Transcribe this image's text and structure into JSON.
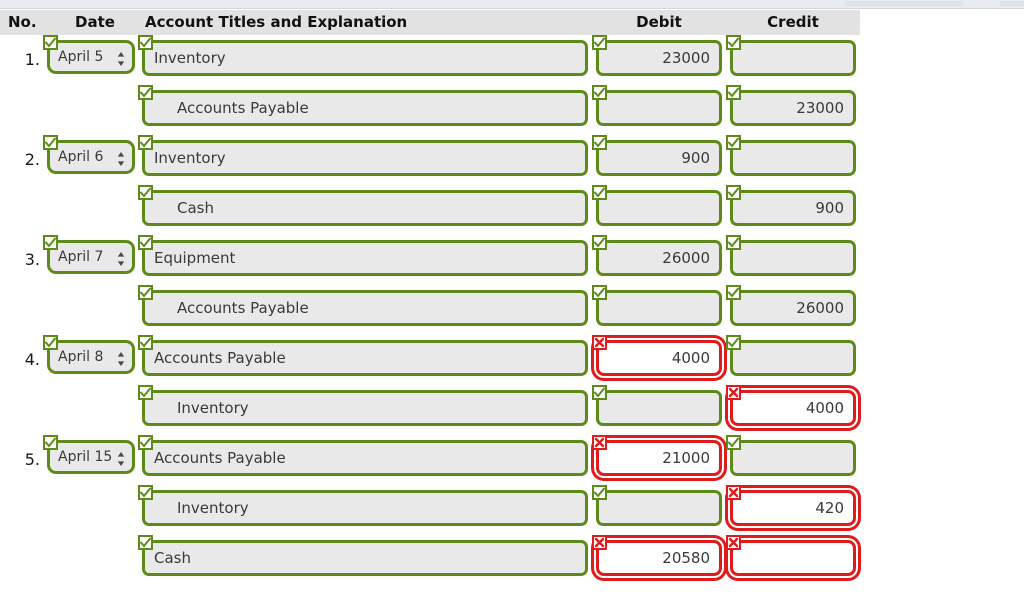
{
  "header": {
    "columns": [
      {
        "key": "no",
        "label": "No."
      },
      {
        "key": "date",
        "label": "Date"
      },
      {
        "key": "acct",
        "label": "Account Titles and Explanation"
      },
      {
        "key": "debit",
        "label": "Debit"
      },
      {
        "key": "credit",
        "label": "Credit"
      }
    ]
  },
  "colors": {
    "valid_border": "#5d8a18",
    "error_border": "#e01b1b",
    "input_bg": "#e9e9e9",
    "header_bg": "#e2e2e2",
    "page_bg": "#ffffff"
  },
  "icons": {
    "check": "check-icon",
    "error": "x-icon",
    "spinner": "updown-arrows-icon"
  },
  "entries": [
    {
      "no": "1.",
      "lines": [
        {
          "date": "April 5",
          "date_status": "valid",
          "account": "Inventory",
          "account_status": "valid",
          "indent": false,
          "debit": "23000",
          "debit_status": "valid",
          "credit": "",
          "credit_status": "valid"
        },
        {
          "date": "",
          "date_status": null,
          "account": "Accounts Payable",
          "account_status": "valid",
          "indent": true,
          "debit": "",
          "debit_status": "valid",
          "credit": "23000",
          "credit_status": "valid"
        }
      ]
    },
    {
      "no": "2.",
      "lines": [
        {
          "date": "April 6",
          "date_status": "valid",
          "account": "Inventory",
          "account_status": "valid",
          "indent": false,
          "debit": "900",
          "debit_status": "valid",
          "credit": "",
          "credit_status": "valid"
        },
        {
          "date": "",
          "date_status": null,
          "account": "Cash",
          "account_status": "valid",
          "indent": true,
          "debit": "",
          "debit_status": "valid",
          "credit": "900",
          "credit_status": "valid"
        }
      ]
    },
    {
      "no": "3.",
      "lines": [
        {
          "date": "April 7",
          "date_status": "valid",
          "account": "Equipment",
          "account_status": "valid",
          "indent": false,
          "debit": "26000",
          "debit_status": "valid",
          "credit": "",
          "credit_status": "valid"
        },
        {
          "date": "",
          "date_status": null,
          "account": "Accounts Payable",
          "account_status": "valid",
          "indent": true,
          "debit": "",
          "debit_status": "valid",
          "credit": "26000",
          "credit_status": "valid"
        }
      ]
    },
    {
      "no": "4.",
      "lines": [
        {
          "date": "April 8",
          "date_status": "valid",
          "account": "Accounts Payable",
          "account_status": "valid",
          "indent": false,
          "debit": "4000",
          "debit_status": "error",
          "credit": "",
          "credit_status": "valid"
        },
        {
          "date": "",
          "date_status": null,
          "account": "Inventory",
          "account_status": "valid",
          "indent": true,
          "debit": "",
          "debit_status": "valid",
          "credit": "4000",
          "credit_status": "error"
        }
      ]
    },
    {
      "no": "5.",
      "lines": [
        {
          "date": "April 15",
          "date_status": "valid",
          "account": "Accounts Payable",
          "account_status": "valid",
          "indent": false,
          "debit": "21000",
          "debit_status": "error",
          "credit": "",
          "credit_status": "valid"
        },
        {
          "date": "",
          "date_status": null,
          "account": "Inventory",
          "account_status": "valid",
          "indent": true,
          "debit": "",
          "debit_status": "valid",
          "credit": "420",
          "credit_status": "error"
        },
        {
          "date": "",
          "date_status": null,
          "account": "Cash",
          "account_status": "valid",
          "indent": false,
          "debit": "20580",
          "debit_status": "error",
          "credit": "",
          "credit_status": "error"
        }
      ]
    }
  ]
}
